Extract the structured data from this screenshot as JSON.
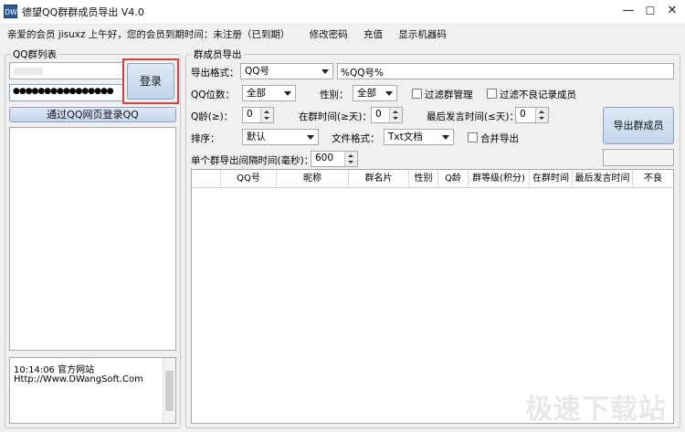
{
  "window": {
    "title": "德望QQ群群成员导出 V4.0",
    "app_icon_text": "DW",
    "min_glyph": "—",
    "max_glyph": "☐",
    "close_glyph": "✕"
  },
  "menu": {
    "greeting": "亲爱的会员 jisuxz 上午好，您的会员到期时间：未注册（已到期）",
    "change_password": "修改密码",
    "recharge": "充值",
    "show_machine_code": "显示机器码"
  },
  "left_panel": {
    "title": "QQ群列表",
    "account_value": "",
    "password_mask": "●●●●●●●●●●●●●●●●",
    "login_button": "登录",
    "web_login_button": "通过QQ网页登录QQ",
    "log_lines": [
      "10:14:06 官方网站",
      "Http://Www.DWangSoft.Com"
    ]
  },
  "right_panel": {
    "title": "群成员导出",
    "export_format_label": "导出格式：",
    "export_format_value": "QQ号",
    "format_template_value": "%QQ号%",
    "qq_digits_label": "QQ位数：",
    "qq_digits_value": "全部",
    "gender_label": "性别：",
    "gender_value": "全部",
    "filter_admin_label": "过滤群管理",
    "filter_bad_label": "过滤不良记录成员",
    "qq_age_label": "Q龄(≥)：",
    "qq_age_value": "0",
    "in_group_label": "在群时间(≥天)：",
    "in_group_value": "0",
    "last_speak_label": "最后发言时间(≤天)：",
    "last_speak_value": "0",
    "export_button": "导出群成员",
    "sort_label": "排序：",
    "sort_value": "默认",
    "file_format_label": "文件格式：",
    "file_format_value": "Txt文档",
    "merge_export_label": "合并导出",
    "interval_label": "单个群导出间隔时间(毫秒)：",
    "interval_value": "600",
    "columns": [
      "",
      "QQ号",
      "昵称",
      "群名片",
      "性别",
      "Q龄",
      "群等级(积分)",
      "在群时间",
      "最后发言时间",
      "不良"
    ]
  },
  "watermark": "极速下载站",
  "colors": {
    "highlight_border": "#d9413c",
    "button_gradient_top": "#dfe9f5",
    "button_gradient_bottom": "#c2d5ec"
  }
}
